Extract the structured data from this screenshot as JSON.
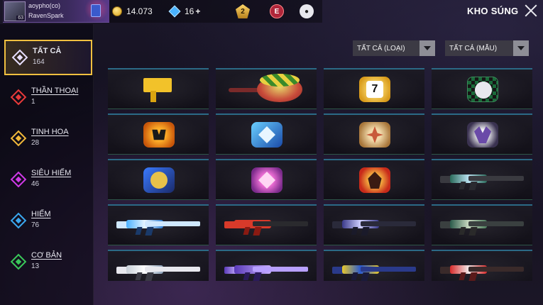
{
  "profile": {
    "name": "aoypho(co)",
    "tag": "RavenSpark",
    "level": "63"
  },
  "currency": {
    "gold": "14.073",
    "diamonds": "16",
    "diamonds_plus": "+"
  },
  "top_icons": {
    "rank_badge": "2",
    "elite_badge": "E"
  },
  "header": {
    "title": "KHO SÚNG"
  },
  "filters": {
    "type": "TẤT CẢ (LOẠI)",
    "color": "TẤT CẢ (MẪU)"
  },
  "categories": [
    {
      "name": "TẤT CẢ",
      "count": "164",
      "color": "#e8e0ff",
      "active": true
    },
    {
      "name": "THẦN THOẠI",
      "count": "1",
      "color": "#e83a3a"
    },
    {
      "name": "TINH HOA",
      "count": "28",
      "color": "#f0b83a"
    },
    {
      "name": "SIÊU HIẾM",
      "count": "46",
      "color": "#d03ae8"
    },
    {
      "name": "HIẾM",
      "count": "76",
      "color": "#3aa8f0"
    },
    {
      "name": "CƠ BẢN",
      "count": "13",
      "color": "#3ac85a"
    }
  ],
  "items": [
    {
      "name": "uzi-skin-icon",
      "art": "uzi"
    },
    {
      "name": "pan-skin-icon",
      "art": "pan"
    },
    {
      "name": "lucky-seven-card-icon",
      "art": "card",
      "style": "card-gold",
      "label": "7"
    },
    {
      "name": "checkered-card-icon",
      "art": "card",
      "style": "card-checker"
    },
    {
      "name": "pumpkin-card-icon",
      "art": "card",
      "style": "card-pumpkin"
    },
    {
      "name": "blue-emblem-card-icon",
      "art": "card",
      "style": "card-blue"
    },
    {
      "name": "tan-emblem-card-icon",
      "art": "card",
      "style": "card-tan"
    },
    {
      "name": "dark-emblem-card-icon",
      "art": "card",
      "style": "card-dark"
    },
    {
      "name": "wave-emblem-card-icon",
      "art": "card",
      "style": "card-wave"
    },
    {
      "name": "pink-emblem-card-icon",
      "art": "card",
      "style": "card-pink"
    },
    {
      "name": "fire-emblem-card-icon",
      "art": "card",
      "style": "card-fire"
    },
    {
      "name": "camo-ak-rifle-icon",
      "art": "gun",
      "style": "g-ak"
    },
    {
      "name": "blue-rifle-icon",
      "art": "gun",
      "style": "g-blue"
    },
    {
      "name": "red-famas-rifle-icon",
      "art": "gun",
      "style": "g-red"
    },
    {
      "name": "purple-rifle-icon",
      "art": "gun",
      "style": "g-purple"
    },
    {
      "name": "camo-smg-icon",
      "art": "gun",
      "style": "g-camo"
    },
    {
      "name": "white-rifle-icon",
      "art": "gun",
      "style": "g-white"
    },
    {
      "name": "violet-shotgun-icon",
      "art": "gun",
      "style": "g-violet"
    },
    {
      "name": "yellow-blue-rifle-icon",
      "art": "gun",
      "style": "g-yellow"
    },
    {
      "name": "red-white-rifle-icon",
      "art": "gun",
      "style": "g-redwhite"
    }
  ]
}
